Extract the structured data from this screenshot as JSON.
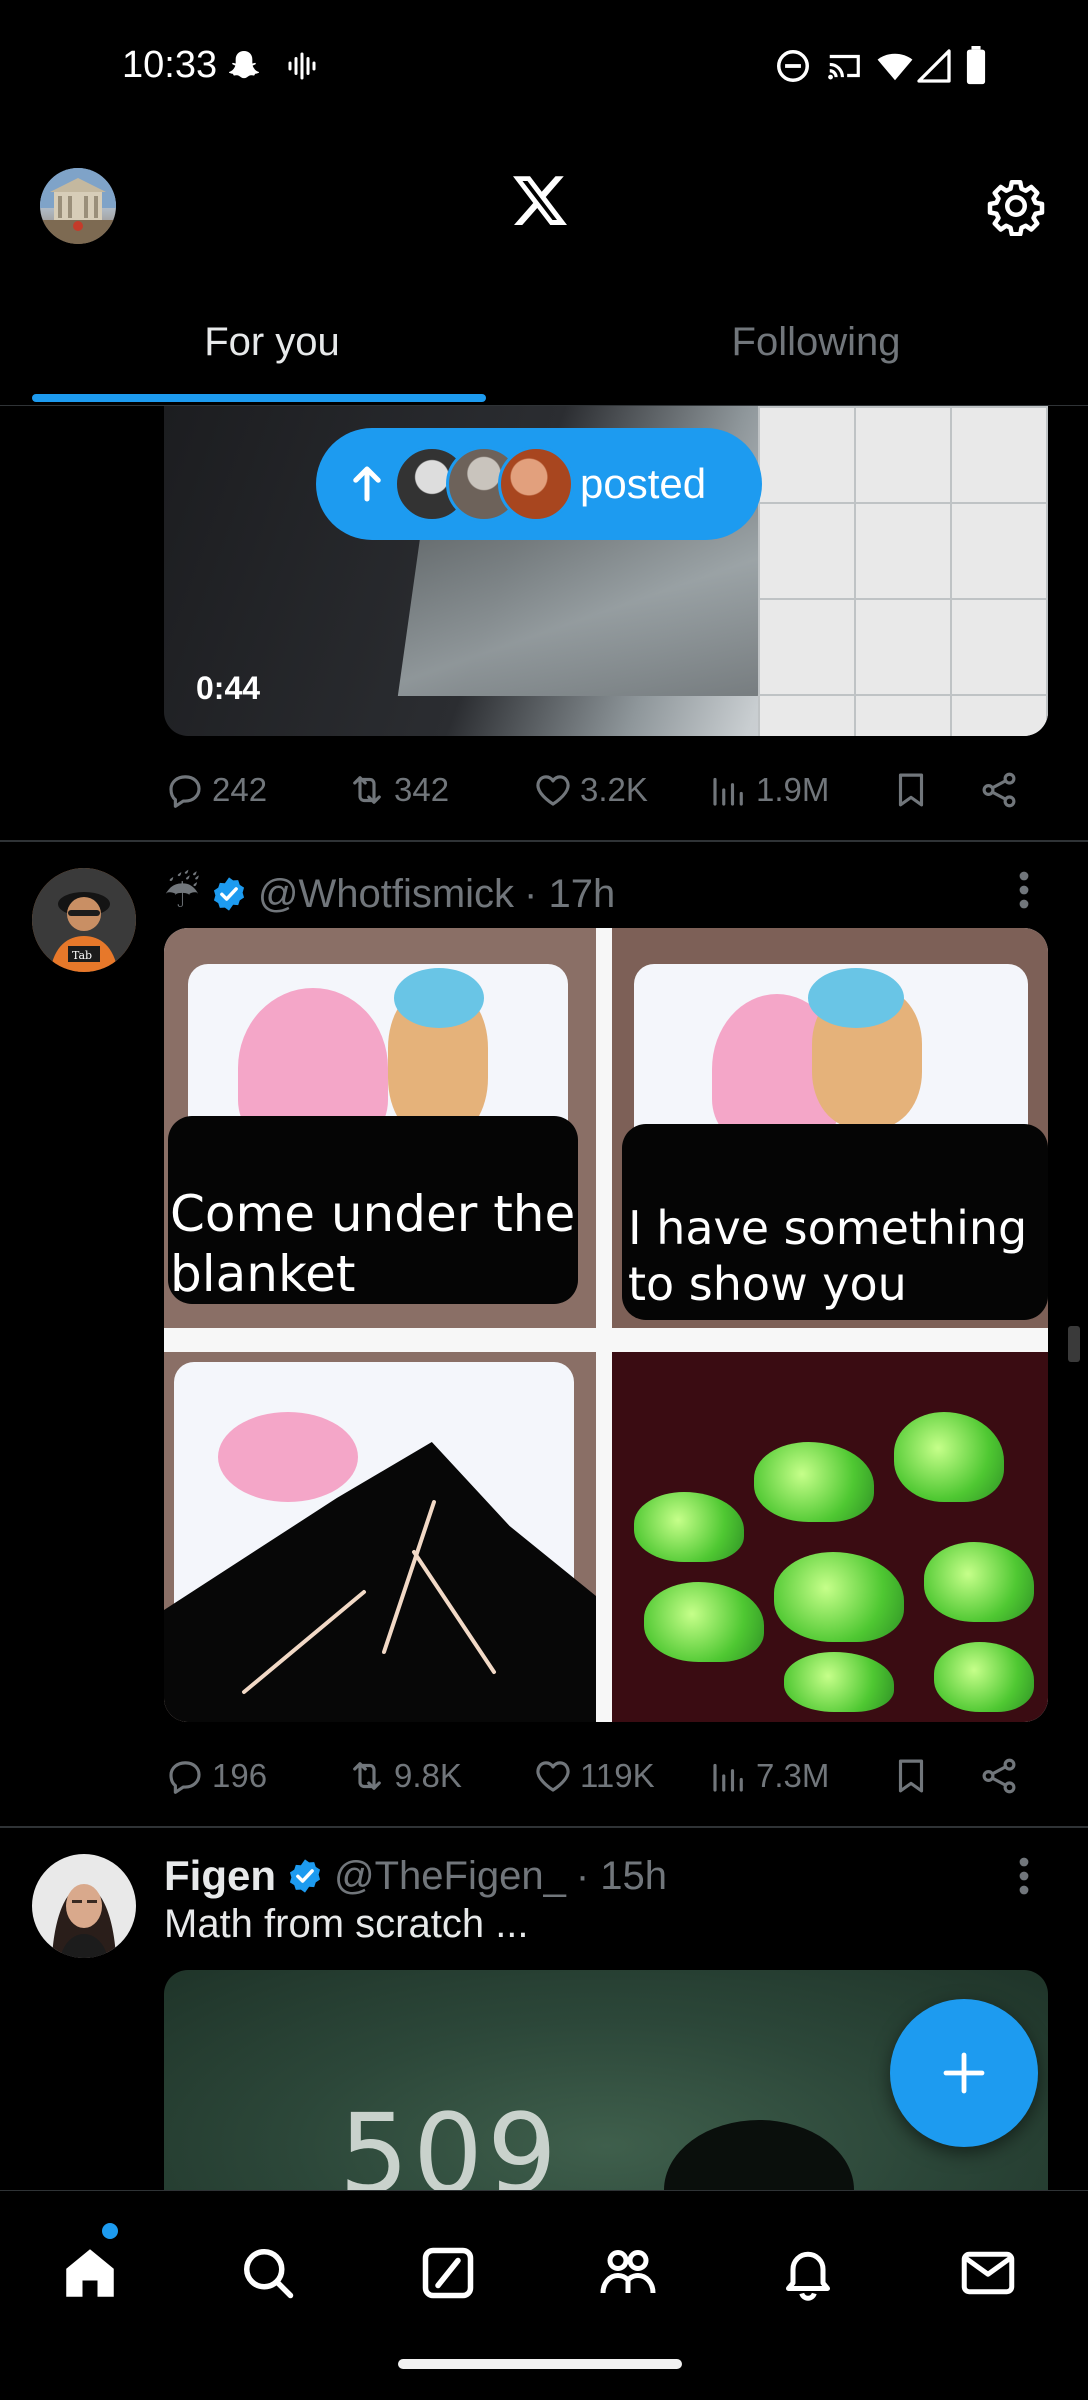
{
  "status_bar": {
    "time": "10:33",
    "icons": [
      "snapchat-icon",
      "audio-wave-icon",
      "dnd-icon",
      "cast-icon",
      "wifi-icon",
      "signal-icon",
      "battery-icon"
    ]
  },
  "header": {
    "logo": "x-logo",
    "settings_icon": "gear-icon"
  },
  "tabs": [
    {
      "label": "For you",
      "active": true
    },
    {
      "label": "Following",
      "active": false
    }
  ],
  "new_posts_pill": {
    "label": "posted",
    "icon": "arrow-up-icon"
  },
  "posts": [
    {
      "media_type": "video",
      "video_duration": "0:44",
      "stats": {
        "replies": "242",
        "reposts": "342",
        "likes": "3.2K",
        "views": "1.9M"
      }
    },
    {
      "display_emoji": "☔",
      "verified": true,
      "handle": "@Whotfismick",
      "time": "· 17h",
      "meme": {
        "caption_1": "Come under the blanket",
        "caption_2": "I have something to show you"
      },
      "stats": {
        "replies": "196",
        "reposts": "9.8K",
        "likes": "119K",
        "views": "7.3M"
      }
    },
    {
      "name": "Figen",
      "verified": true,
      "handle": "@TheFigen_",
      "time": "· 15h",
      "text": "Math from scratch ...",
      "image_text": "509"
    }
  ],
  "fab": {
    "icon": "plus-icon"
  },
  "bottom_nav": [
    {
      "name": "home",
      "icon": "home-icon",
      "active": true,
      "has_dot": true
    },
    {
      "name": "search",
      "icon": "search-icon"
    },
    {
      "name": "grok",
      "icon": "grok-icon"
    },
    {
      "name": "communities",
      "icon": "people-icon"
    },
    {
      "name": "notifications",
      "icon": "bell-icon"
    },
    {
      "name": "messages",
      "icon": "mail-icon"
    }
  ],
  "colors": {
    "accent": "#1d9bf0",
    "background": "#000000",
    "muted": "#71767b",
    "text": "#e7e9ea"
  }
}
